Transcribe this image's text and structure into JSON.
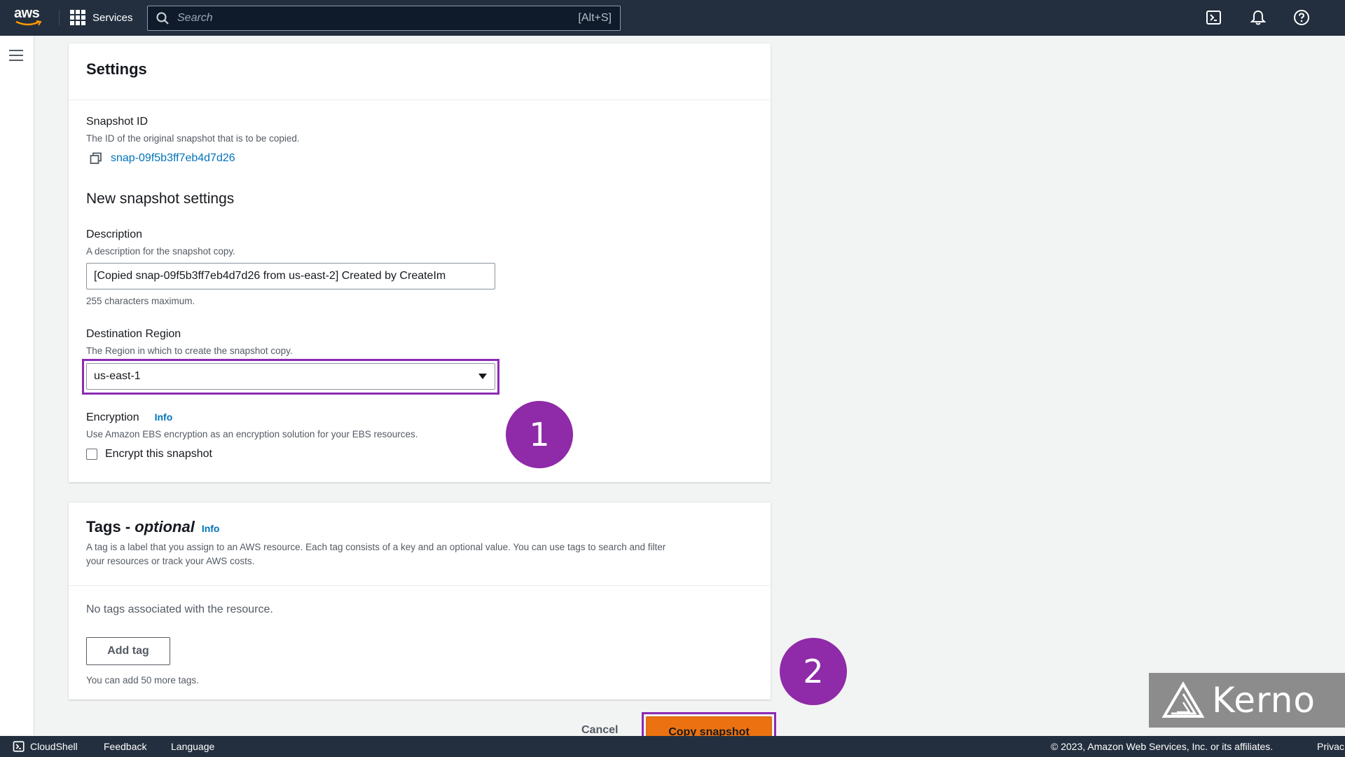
{
  "topnav": {
    "logo_text": "aws",
    "services_label": "Services",
    "search_placeholder": "Search",
    "search_shortcut": "[Alt+S]",
    "icons": [
      "cloudshell-icon",
      "bell-icon",
      "help-icon"
    ]
  },
  "settings": {
    "title": "Settings",
    "snapshot_id_label": "Snapshot ID",
    "snapshot_id_desc": "The ID of the original snapshot that is to be copied.",
    "snapshot_id_value": "snap-09f5b3ff7eb4d7d26",
    "new_settings_title": "New snapshot settings",
    "description_label": "Description",
    "description_desc": "A description for the snapshot copy.",
    "description_value": "[Copied snap-09f5b3ff7eb4d7d26 from us-east-2] Created by CreateIm",
    "description_hint": "255 characters maximum.",
    "region_label": "Destination Region",
    "region_desc": "The Region in which to create the snapshot copy.",
    "region_value": "us-east-1",
    "encryption_label": "Encryption",
    "encryption_info": "Info",
    "encryption_desc": "Use Amazon EBS encryption as an encryption solution for your EBS resources.",
    "encrypt_checkbox_label": "Encrypt this snapshot"
  },
  "tags": {
    "title_prefix": "Tags - ",
    "title_optional": "optional",
    "info": "Info",
    "desc_line1": "A tag is a label that you assign to an AWS resource. Each tag consists of a key and an optional value. You can use tags to search and filter",
    "desc_line2": "your resources or track your AWS costs.",
    "empty_text": "No tags associated with the resource.",
    "add_tag_label": "Add tag",
    "limit_text": "You can add 50 more tags."
  },
  "actions": {
    "cancel_label": "Cancel",
    "copy_label": "Copy snapshot"
  },
  "annotations": {
    "step1": "1",
    "step2": "2",
    "highlight_color": "#8c2bb3"
  },
  "watermark": {
    "text": "Kerno"
  },
  "footer": {
    "cloudshell": "CloudShell",
    "feedback": "Feedback",
    "language": "Language",
    "copyright": "© 2023, Amazon Web Services, Inc. or its affiliates.",
    "privacy": "Privac"
  }
}
